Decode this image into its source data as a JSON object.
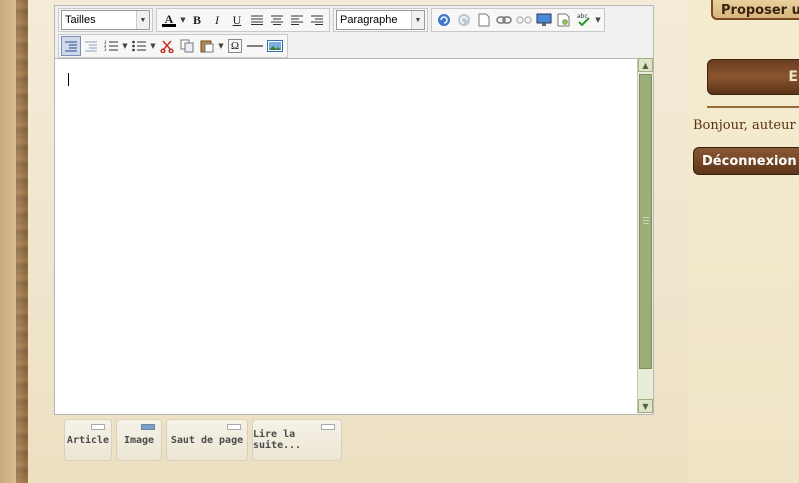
{
  "toolbar": {
    "size_select": "Tailles",
    "format_select": "Paragraphe",
    "bold": "B",
    "italic": "I",
    "underline": "U",
    "text_color": "A",
    "special_char": "Ω"
  },
  "bottom_tabs": [
    {
      "label": "Article"
    },
    {
      "label": "Image"
    },
    {
      "label": "Saut de page"
    },
    {
      "label": "Lire la suite..."
    }
  ],
  "right": {
    "propose_label": "Proposer u",
    "wood_label": "E",
    "greeting": "Bonjour, auteur",
    "logout_label": "Déconnexion"
  },
  "colors": {
    "accent": "#7a4a22",
    "scrollbar": "#9bae7a"
  }
}
